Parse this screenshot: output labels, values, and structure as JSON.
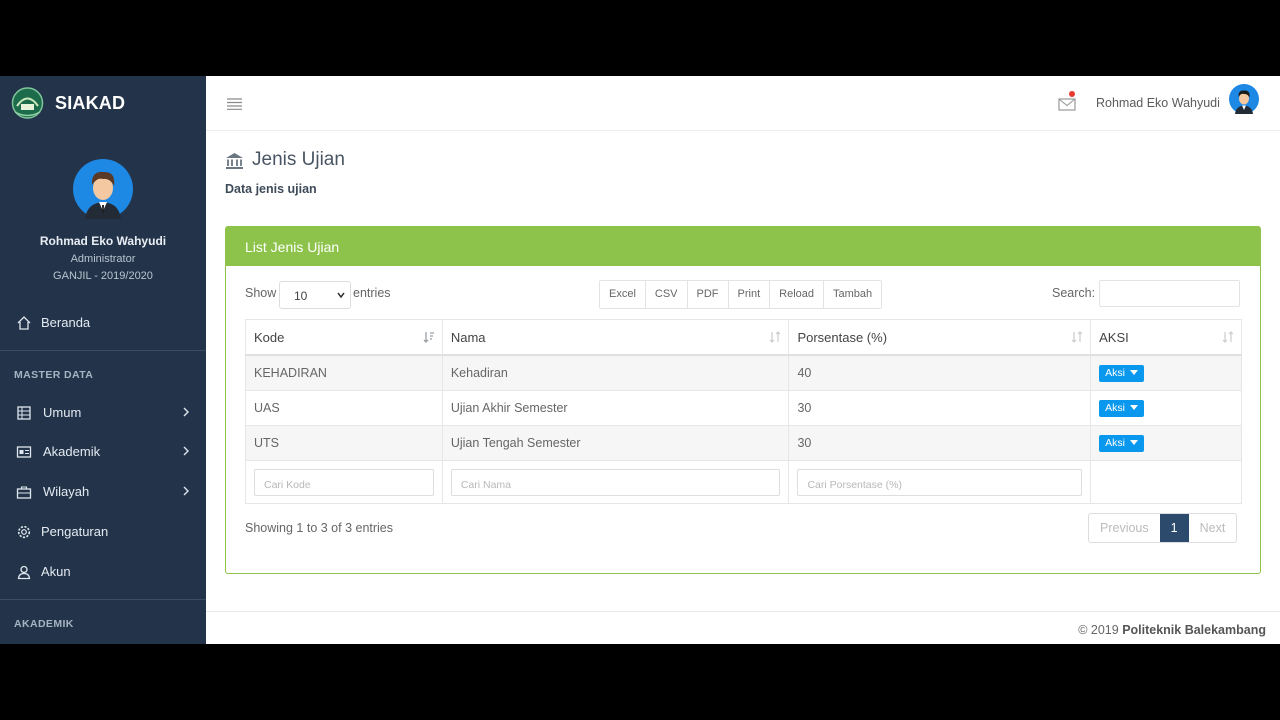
{
  "app": {
    "brand": "SIAKAD"
  },
  "sidebar": {
    "profile": {
      "name": "Rohmad Eko Wahyudi",
      "role": "Administrator",
      "term": "GANJIL - 2019/2020"
    },
    "home": {
      "label": "Beranda",
      "icon": "home-icon"
    },
    "sections": [
      "MASTER DATA",
      "AKADEMIK"
    ],
    "items": [
      {
        "label": "Umum",
        "icon": "building-icon"
      },
      {
        "label": "Akademik",
        "icon": "id-card-icon"
      },
      {
        "label": "Wilayah",
        "icon": "briefcase-icon"
      },
      {
        "label": "Pengaturan",
        "icon": "gear-icon"
      },
      {
        "label": "Akun",
        "icon": "user-icon"
      }
    ]
  },
  "header": {
    "user_name": "Rohmad Eko Wahyudi"
  },
  "page": {
    "title": "Jenis Ujian",
    "subtitle": "Data jenis ujian"
  },
  "panel": {
    "title": "List Jenis Ujian",
    "show_label": "Show",
    "page_length": "10",
    "entries_label": "entries",
    "buttons": [
      "Excel",
      "CSV",
      "PDF",
      "Print",
      "Reload",
      "Tambah"
    ],
    "search_label": "Search:",
    "columns": [
      "Kode",
      "Nama",
      "Porsentase (%)",
      "AKSI"
    ],
    "rows": [
      {
        "kode": "KEHADIRAN",
        "nama": "Kehadiran",
        "porsentase": "40",
        "aksi": "Aksi"
      },
      {
        "kode": "UAS",
        "nama": "Ujian Akhir Semester",
        "porsentase": "30",
        "aksi": "Aksi"
      },
      {
        "kode": "UTS",
        "nama": "Ujian Tengah Semester",
        "porsentase": "30",
        "aksi": "Aksi"
      }
    ],
    "filters": {
      "kode": "Cari Kode",
      "nama": "Cari Nama",
      "porsentase": "Cari Porsentase (%)"
    },
    "info": "Showing 1 to 3 of 3 entries",
    "pagination": {
      "previous": "Previous",
      "current": "1",
      "next": "Next"
    }
  },
  "footer": {
    "copyright": "© 2019",
    "org": "Politeknik Balekambang"
  }
}
